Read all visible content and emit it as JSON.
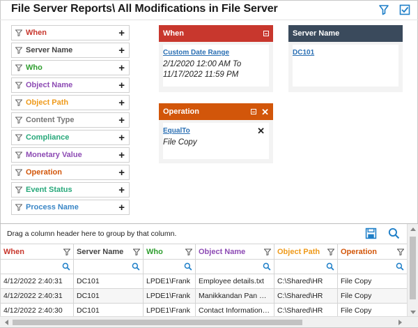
{
  "title": "File Server Reports\\ All Modifications in File Server",
  "top_icons": [
    "filter-icon",
    "checkbox-icon"
  ],
  "colors": {
    "when": "#c8372d",
    "server": "#444444",
    "who": "#2f9e2f",
    "object_name": "#8d4bb4",
    "object_path": "#ef9a1a",
    "content_type": "#777777",
    "compliance": "#27a87a",
    "monetary": "#8d4bb4",
    "operation": "#d2560a",
    "event_status": "#27a87a",
    "process": "#3a86c6",
    "server_card": "#3a4a5c",
    "link": "#2a6fb3"
  },
  "filters": [
    {
      "label": "When",
      "color": "#c8372d"
    },
    {
      "label": "Server Name",
      "color": "#444444"
    },
    {
      "label": "Who",
      "color": "#2f9e2f"
    },
    {
      "label": "Object Name",
      "color": "#8d4bb4"
    },
    {
      "label": "Object Path",
      "color": "#ef9a1a"
    },
    {
      "label": "Content Type",
      "color": "#777777"
    },
    {
      "label": "Compliance",
      "color": "#27a87a"
    },
    {
      "label": "Monetary Value",
      "color": "#8d4bb4"
    },
    {
      "label": "Operation",
      "color": "#d2560a"
    },
    {
      "label": "Event Status",
      "color": "#27a87a"
    },
    {
      "label": "Process Name",
      "color": "#3a86c6"
    }
  ],
  "cards": {
    "when": {
      "title": "When",
      "link": "Custom Date Range",
      "value_line1": "2/1/2020 12:00 AM To",
      "value_line2": "11/17/2022 11:59 PM"
    },
    "server": {
      "title": "Server Name",
      "link": "DC101"
    },
    "operation": {
      "title": "Operation",
      "link": "EqualTo",
      "value": "File Copy"
    }
  },
  "grid": {
    "group_hint": "Drag a column header here to group by that column.",
    "columns": [
      {
        "label": "When",
        "color": "#c8372d"
      },
      {
        "label": "Server Name",
        "color": "#444444"
      },
      {
        "label": "Who",
        "color": "#2f9e2f"
      },
      {
        "label": "Object Name",
        "color": "#8d4bb4"
      },
      {
        "label": "Object Path",
        "color": "#ef9a1a"
      },
      {
        "label": "Operation",
        "color": "#d2560a"
      }
    ],
    "rows": [
      [
        "4/12/2022 2:40:31",
        "DC101",
        "LPDE1\\Frank",
        "Employee details.txt",
        "C:\\Shared\\HR",
        "File Copy"
      ],
      [
        "4/12/2022 2:40:31",
        "DC101",
        "LPDE1\\Frank",
        "Manikkandan Pan Card.pdf",
        "C:\\Shared\\HR",
        "File Copy"
      ],
      [
        "4/12/2022 2:40:30",
        "DC101",
        "LPDE1\\Frank",
        "Contact Information.xlsx",
        "C:\\Shared\\HR",
        "File Copy"
      ]
    ]
  }
}
